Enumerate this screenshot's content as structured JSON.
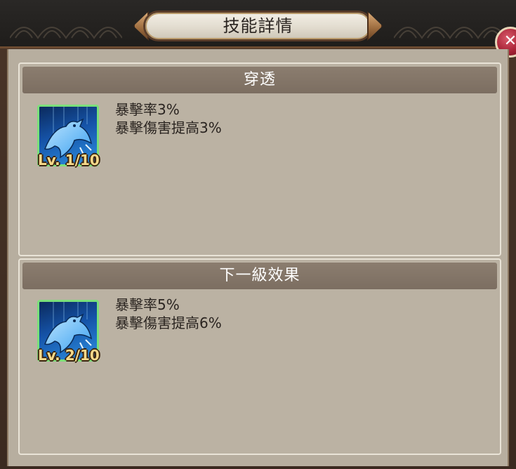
{
  "window": {
    "title": "技能詳情",
    "close_label": "✕"
  },
  "current": {
    "header": "穿透",
    "icon": "blue-bird-skill-icon",
    "level_prefix": "Lv.",
    "level_value": "1/10",
    "effects": [
      "暴擊率3%",
      "暴擊傷害提高3%"
    ]
  },
  "next": {
    "header": "下一級效果",
    "icon": "blue-bird-skill-icon",
    "level_prefix": "Lv.",
    "level_value": "2/10",
    "effects": [
      "暴擊率5%",
      "暴擊傷害提高6%"
    ]
  },
  "colors": {
    "header_bg": "#7c6e61",
    "panel_bg": "#b7ae9f",
    "icon_border": "#7be07a",
    "level_text": "#f6d98a"
  }
}
